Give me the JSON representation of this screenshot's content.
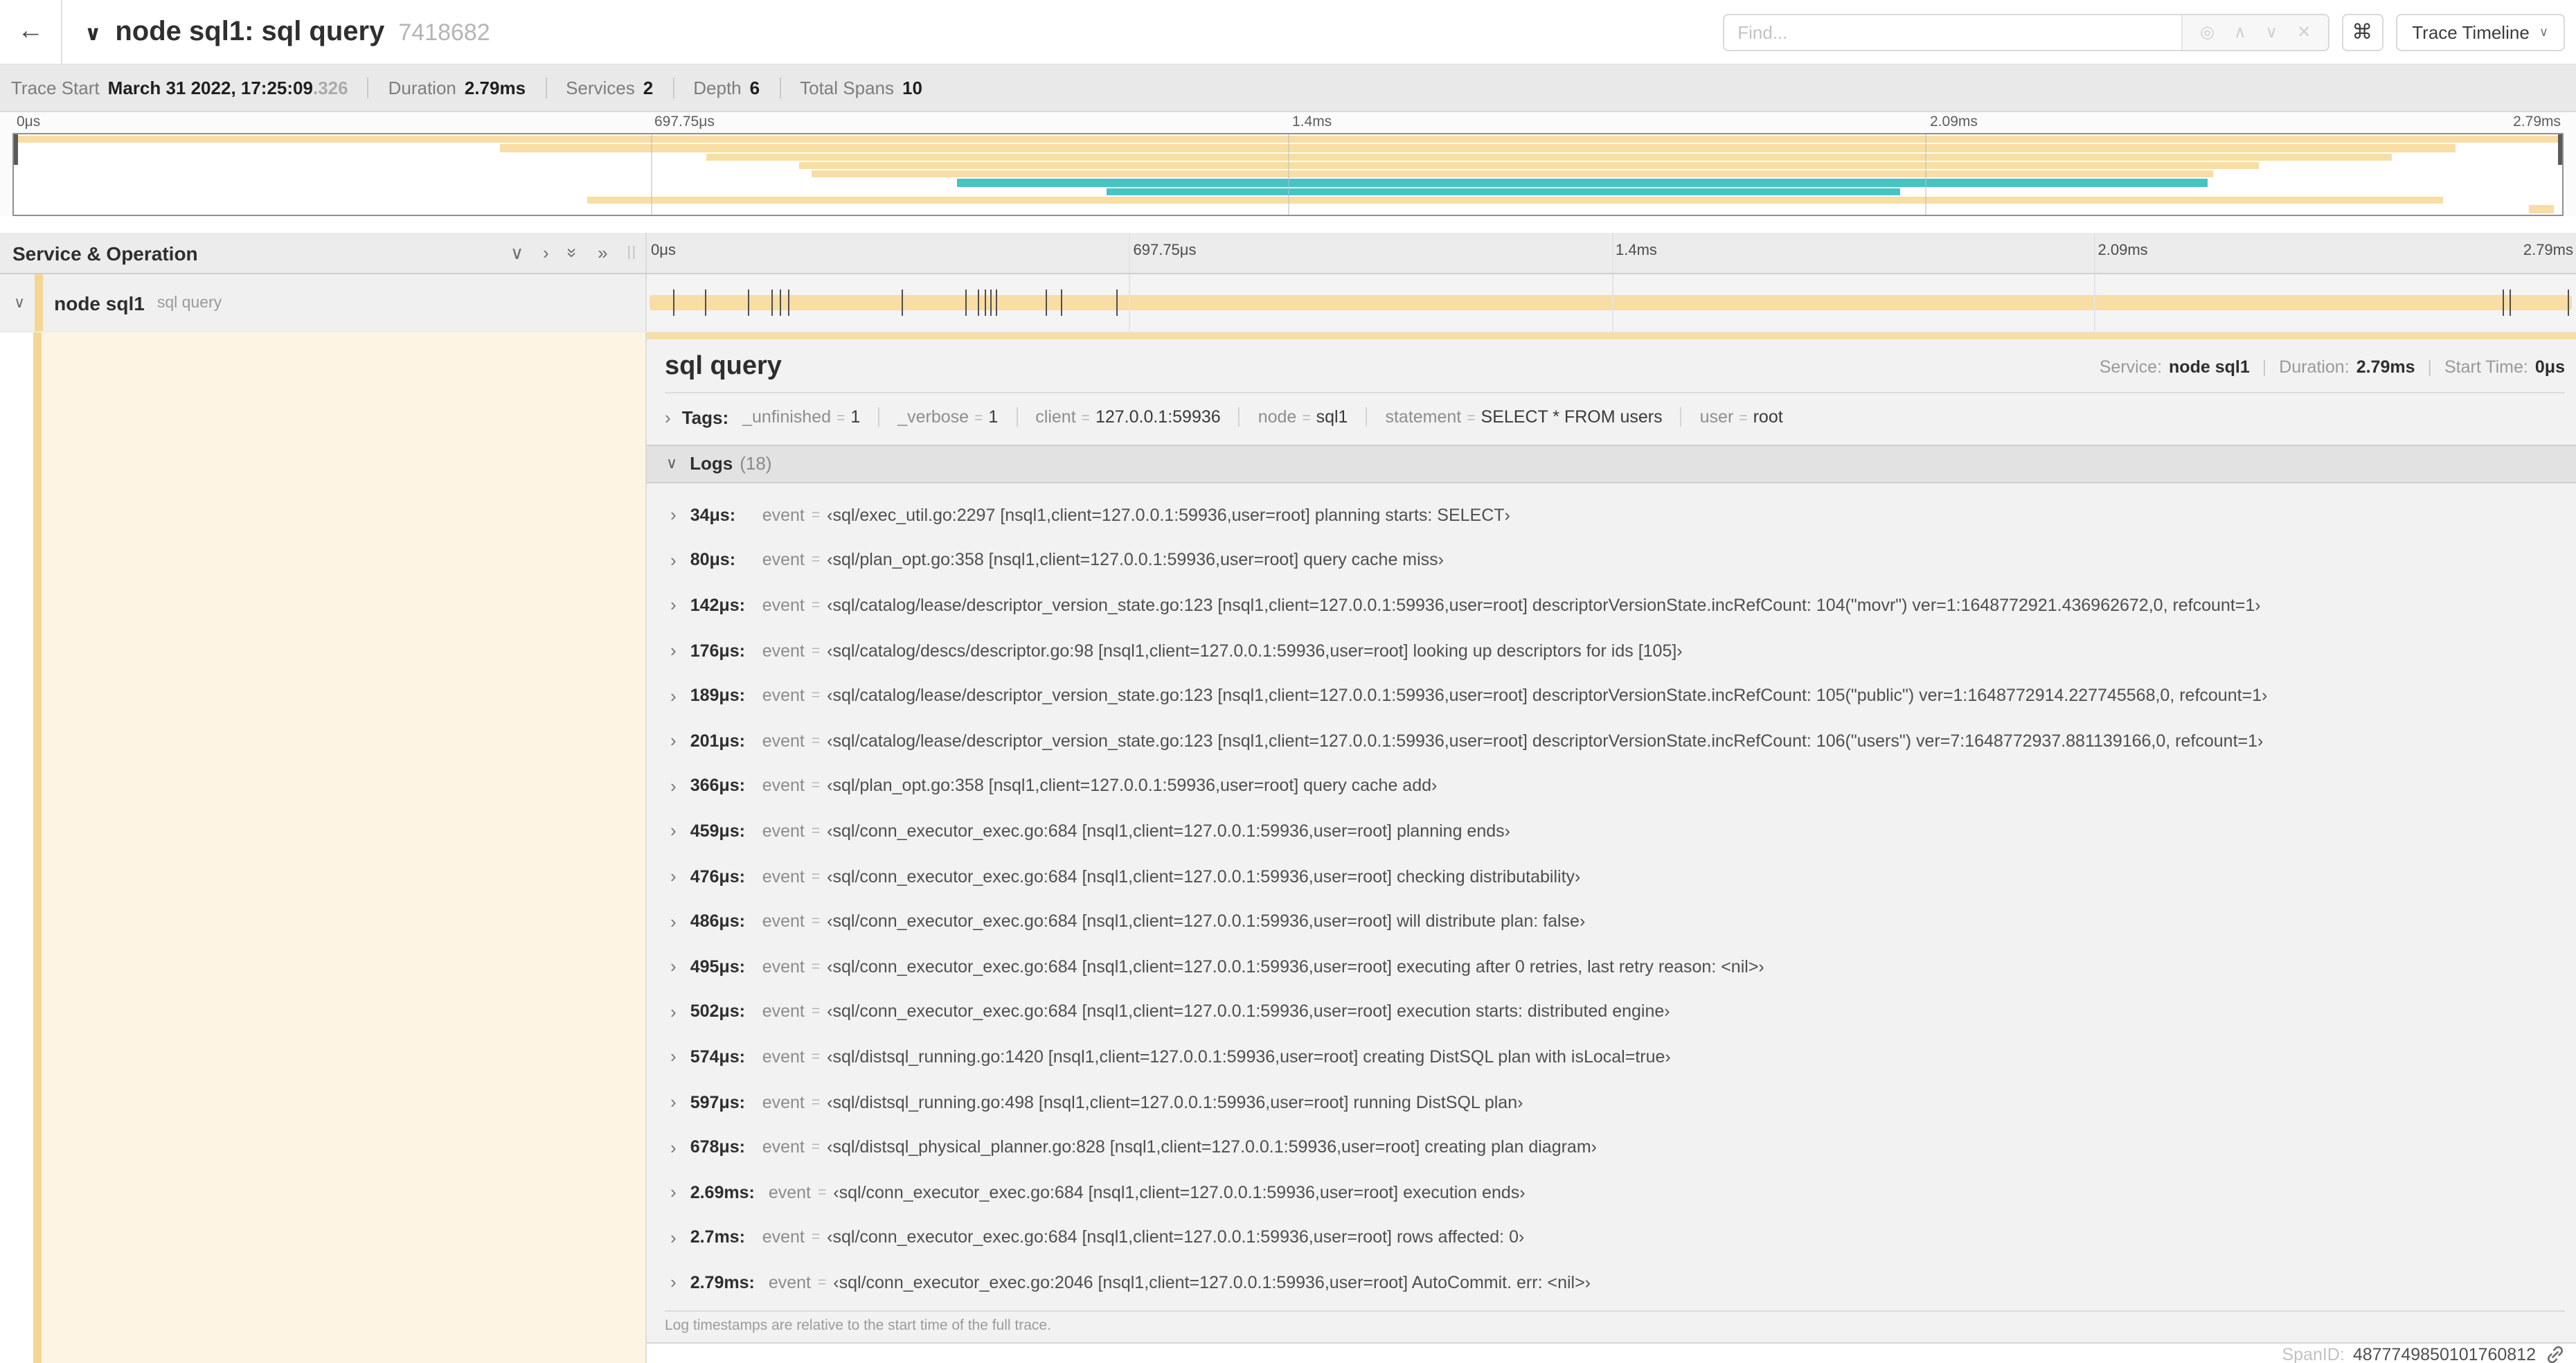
{
  "colors": {
    "span_tan": "#f8dda5",
    "span_teal": "#46c3c3",
    "stripe_tan": "#f5d795",
    "detail_cream": "#fdf4e3"
  },
  "header": {
    "back_label": "←",
    "collapse_chevron": "∨",
    "title": "node sql1: sql query",
    "trace_id": "7418682",
    "find_placeholder": "Find...",
    "find_icons": [
      {
        "name": "locate-icon",
        "glyph": "◎"
      },
      {
        "name": "prev-result-icon",
        "glyph": "∧"
      },
      {
        "name": "next-result-icon",
        "glyph": "∨"
      },
      {
        "name": "clear-search-icon",
        "glyph": "✕"
      }
    ],
    "shortcut_glyph": "⌘",
    "view_select_label": "Trace Timeline",
    "view_select_chevron": "∨"
  },
  "summary": {
    "items": [
      {
        "label": "Trace Start",
        "value": "March 31 2022, 17:25:09",
        "suffix": ".326"
      },
      {
        "label": "Duration",
        "value": "2.79ms"
      },
      {
        "label": "Services",
        "value": "2"
      },
      {
        "label": "Depth",
        "value": "6"
      },
      {
        "label": "Total Spans",
        "value": "10"
      }
    ]
  },
  "axis": {
    "labels": [
      {
        "label": "0μs",
        "pct": 0,
        "align": "left"
      },
      {
        "label": "697.75μs",
        "pct": 25,
        "align": "left"
      },
      {
        "label": "1.4ms",
        "pct": 50,
        "align": "left"
      },
      {
        "label": "2.09ms",
        "pct": 75,
        "align": "left"
      },
      {
        "label": "2.79ms",
        "pct": 100,
        "align": "right"
      }
    ],
    "gridlines": [
      25,
      50,
      75
    ]
  },
  "minimap": {
    "spans": [
      {
        "start": 0,
        "end": 100,
        "color": "span_tan"
      },
      {
        "start": 19.1,
        "end": 95.8,
        "color": "span_tan"
      },
      {
        "start": 27.2,
        "end": 93.3,
        "color": "span_tan"
      },
      {
        "start": 30.8,
        "end": 88.1,
        "color": "span_tan"
      },
      {
        "start": 31.3,
        "end": 86.3,
        "color": "span_tan"
      },
      {
        "start": 37.0,
        "end": 86.1,
        "color": "span_teal"
      },
      {
        "start": 42.9,
        "end": 74.0,
        "color": "span_teal"
      },
      {
        "start": 22.5,
        "end": 95.3,
        "color": "span_tan"
      },
      {
        "start": 98.7,
        "end": 99.7,
        "color": "span_tan"
      }
    ]
  },
  "timeline_header": {
    "column_title": "Service & Operation",
    "icons": [
      {
        "name": "collapse-one-icon",
        "glyph": "∨",
        "rotate": false
      },
      {
        "name": "expand-one-icon",
        "glyph": "›",
        "rotate": false
      },
      {
        "name": "collapse-all-icon",
        "glyph": "»",
        "rotate": true
      },
      {
        "name": "expand-all-icon",
        "glyph": "»",
        "rotate": false
      }
    ],
    "grip": "||"
  },
  "span_row": {
    "chevron": "∨",
    "service": "node sql1",
    "operation": "sql query",
    "tick_pcts": [
      1.22,
      2.87,
      5.09,
      6.31,
      6.77,
      7.2,
      13.12,
      16.45,
      17.06,
      17.42,
      17.74,
      17.99,
      20.57,
      21.4,
      24.3,
      96.42,
      96.77,
      99.8
    ]
  },
  "detail": {
    "title": "sql query",
    "meta": [
      {
        "label": "Service:",
        "value": "node sql1"
      },
      {
        "label": "Duration:",
        "value": "2.79ms"
      },
      {
        "label": "Start Time:",
        "value": "0μs"
      }
    ],
    "tags_chevron": "›",
    "tags_label": "Tags:",
    "tags": [
      {
        "key": "_unfinished",
        "value": "1"
      },
      {
        "key": "_verbose",
        "value": "1"
      },
      {
        "key": "client",
        "value": "127.0.0.1:59936"
      },
      {
        "key": "node",
        "value": "sql1"
      },
      {
        "key": "statement",
        "value": "SELECT * FROM users"
      },
      {
        "key": "user",
        "value": "root"
      }
    ],
    "logs": {
      "chevron": "∨",
      "label": "Logs",
      "count": "(18)",
      "field_key": "event",
      "entries": [
        {
          "time": "34μs:",
          "value": "‹sql/exec_util.go:2297 [nsql1,client=127.0.0.1:59936,user=root] planning starts: SELECT›"
        },
        {
          "time": "80μs:",
          "value": "‹sql/plan_opt.go:358 [nsql1,client=127.0.0.1:59936,user=root] query cache miss›"
        },
        {
          "time": "142μs:",
          "value": "‹sql/catalog/lease/descriptor_version_state.go:123 [nsql1,client=127.0.0.1:59936,user=root] descriptorVersionState.incRefCount: 104(\"movr\") ver=1:1648772921.436962672,0, refcount=1›"
        },
        {
          "time": "176μs:",
          "value": "‹sql/catalog/descs/descriptor.go:98 [nsql1,client=127.0.0.1:59936,user=root] looking up descriptors for ids [105]›"
        },
        {
          "time": "189μs:",
          "value": "‹sql/catalog/lease/descriptor_version_state.go:123 [nsql1,client=127.0.0.1:59936,user=root] descriptorVersionState.incRefCount: 105(\"public\") ver=1:1648772914.227745568,0, refcount=1›"
        },
        {
          "time": "201μs:",
          "value": "‹sql/catalog/lease/descriptor_version_state.go:123 [nsql1,client=127.0.0.1:59936,user=root] descriptorVersionState.incRefCount: 106(\"users\") ver=7:1648772937.881139166,0, refcount=1›"
        },
        {
          "time": "366μs:",
          "value": "‹sql/plan_opt.go:358 [nsql1,client=127.0.0.1:59936,user=root] query cache add›"
        },
        {
          "time": "459μs:",
          "value": "‹sql/conn_executor_exec.go:684 [nsql1,client=127.0.0.1:59936,user=root] planning ends›"
        },
        {
          "time": "476μs:",
          "value": "‹sql/conn_executor_exec.go:684 [nsql1,client=127.0.0.1:59936,user=root] checking distributability›"
        },
        {
          "time": "486μs:",
          "value": "‹sql/conn_executor_exec.go:684 [nsql1,client=127.0.0.1:59936,user=root] will distribute plan: false›"
        },
        {
          "time": "495μs:",
          "value": "‹sql/conn_executor_exec.go:684 [nsql1,client=127.0.0.1:59936,user=root] executing after 0 retries, last retry reason: <nil>›"
        },
        {
          "time": "502μs:",
          "value": "‹sql/conn_executor_exec.go:684 [nsql1,client=127.0.0.1:59936,user=root] execution starts: distributed engine›"
        },
        {
          "time": "574μs:",
          "value": "‹sql/distsql_running.go:1420 [nsql1,client=127.0.0.1:59936,user=root] creating DistSQL plan with isLocal=true›"
        },
        {
          "time": "597μs:",
          "value": "‹sql/distsql_running.go:498 [nsql1,client=127.0.0.1:59936,user=root] running DistSQL plan›"
        },
        {
          "time": "678μs:",
          "value": "‹sql/distsql_physical_planner.go:828 [nsql1,client=127.0.0.1:59936,user=root] creating plan diagram›"
        },
        {
          "time": "2.69ms:",
          "value": "‹sql/conn_executor_exec.go:684 [nsql1,client=127.0.0.1:59936,user=root] execution ends›"
        },
        {
          "time": "2.7ms:",
          "value": "‹sql/conn_executor_exec.go:684 [nsql1,client=127.0.0.1:59936,user=root] rows affected: 0›"
        },
        {
          "time": "2.79ms:",
          "value": "‹sql/conn_executor_exec.go:2046 [nsql1,client=127.0.0.1:59936,user=root] AutoCommit. err: <nil>›"
        }
      ]
    },
    "logs_note": "Log timestamps are relative to the start time of the full trace.",
    "spanid_label": "SpanID:",
    "spanid_value": "4877749850101760812"
  }
}
